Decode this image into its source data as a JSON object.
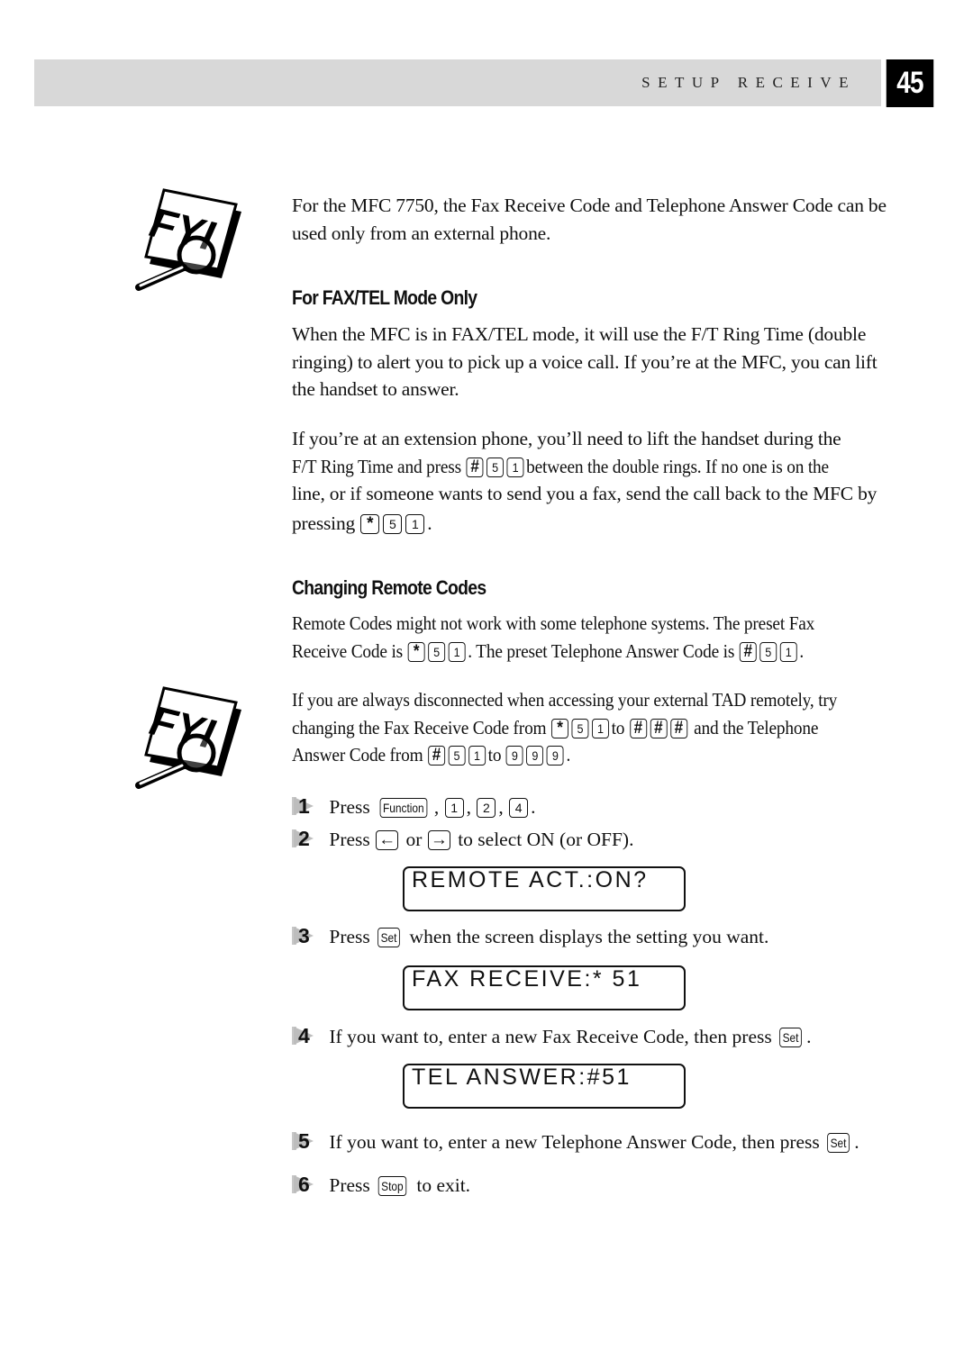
{
  "header": {
    "section_title": "SETUP RECEIVE",
    "page_number": "45",
    "bar_color": "#d8d8d8"
  },
  "fyi_icons": [
    {
      "label": "FYI"
    },
    {
      "label": "FYI"
    }
  ],
  "note1": {
    "text": "For the MFC 7750, the Fax Receive Code and Telephone Answer Code can be used only from an external phone."
  },
  "section_fax_tel": {
    "heading": "For FAX/TEL Mode Only",
    "para1": "When the MFC is in FAX/TEL mode, it will use the F/T Ring Time (double ringing) to alert you to pick up a voice call. If you’re at the MFC, you can lift the handset to answer.",
    "para2": {
      "line1": "If you’re at an extension phone, you’ll need to lift the handset during the",
      "line2_pre": "F/T Ring Time and press",
      "line2_keys": [
        "#",
        "5",
        "1"
      ],
      "line2_post": "between the double rings. If no one is on the",
      "line3": "line, or if someone wants to send you a fax, send the call back to the MFC by",
      "line4_pre": "pressing",
      "line4_keys": [
        "*",
        "5",
        "1"
      ],
      "line4_post": "."
    }
  },
  "section_remote": {
    "heading": "Changing Remote Codes",
    "para1": {
      "line1": "Remote Codes might not work with some telephone systems. The preset Fax",
      "line2_pre": "Receive Code is",
      "fax_keys": [
        "*",
        "5",
        "1"
      ],
      "line2_mid": ". The preset Telephone Answer Code is",
      "tel_keys": [
        "#",
        "5",
        "1"
      ],
      "line2_post": "."
    },
    "note2": {
      "line1": "If you are always disconnected when accessing your external TAD remotely, try",
      "line2_pre": "changing the Fax Receive Code from",
      "from_fax_keys": [
        "*",
        "5",
        "1"
      ],
      "to": "to",
      "to_fax_keys": [
        "#",
        "#",
        "#"
      ],
      "line2_post": "and the Telephone",
      "line3_pre": "Answer Code from",
      "from_tel_keys": [
        "#",
        "5",
        "1"
      ],
      "to_tel_keys": [
        "9",
        "9",
        "9"
      ],
      "line3_post": "."
    }
  },
  "steps": [
    {
      "num": "1",
      "pre": "Press",
      "keys": [
        "Function",
        "1",
        "2",
        "4"
      ],
      "post": "."
    },
    {
      "num": "2",
      "pre": "Press",
      "key_left": "←",
      "mid": "or",
      "key_right": "→",
      "post": "to select ON (or OFF)."
    },
    {
      "num": "3",
      "pre": "Press",
      "key": "Set",
      "post": "when the screen displays the setting you want."
    },
    {
      "num": "4",
      "pre": "If you want to, enter a new Fax Receive Code, then press",
      "key": "Set",
      "post": "."
    },
    {
      "num": "5",
      "pre": "If you want to, enter a new Telephone Answer Code, then press",
      "key": "Set",
      "post": "."
    },
    {
      "num": "6",
      "pre": "Press",
      "key": "Stop",
      "post": "to exit."
    }
  ],
  "lcd_displays": [
    "REMOTE ACT.:ON?",
    "FAX RECEIVE:* 51",
    "TEL ANSWER:#51"
  ]
}
